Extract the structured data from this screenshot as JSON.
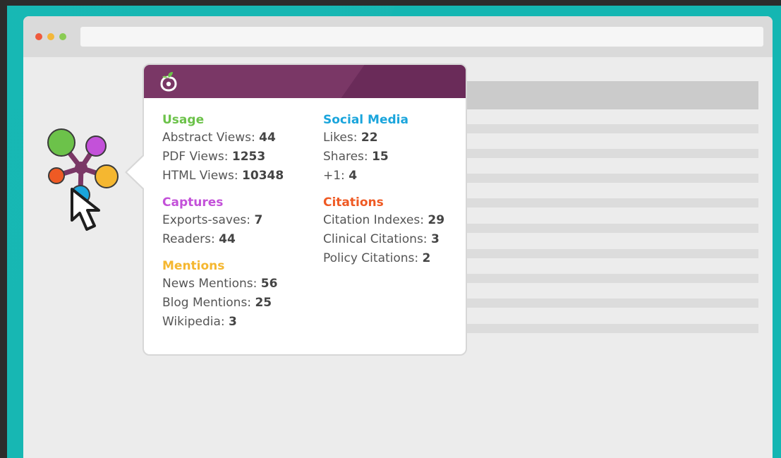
{
  "colors": {
    "teal": "#14b6b2",
    "header_purple": "#7a3766",
    "usage_green": "#6cc24a",
    "social_blue": "#1aa5dc",
    "captures_purple": "#c351d9",
    "citations_orange": "#ef5a24",
    "mentions_yellow": "#f5b730"
  },
  "browser": {
    "window_dots": [
      "close-dot",
      "minimize-dot",
      "maximize-dot"
    ]
  },
  "badge": {
    "icon": "plumx-flower-icon"
  },
  "popup": {
    "logo_icon": "plumx-logo-icon",
    "usage": {
      "title": "Usage",
      "rows": [
        {
          "label": "Abstract Views:",
          "value": "44"
        },
        {
          "label": "PDF Views:",
          "value": "1253"
        },
        {
          "label": "HTML Views:",
          "value": "10348"
        }
      ]
    },
    "captures": {
      "title": "Captures",
      "rows": [
        {
          "label": "Exports-saves:",
          "value": "7"
        },
        {
          "label": "Readers:",
          "value": "44"
        }
      ]
    },
    "mentions": {
      "title": "Mentions",
      "rows": [
        {
          "label": "News Mentions:",
          "value": "56"
        },
        {
          "label": "Blog Mentions:",
          "value": "25"
        },
        {
          "label": "Wikipedia:",
          "value": "3"
        }
      ]
    },
    "social_media": {
      "title": "Social Media",
      "rows": [
        {
          "label": "Likes:",
          "value": "22"
        },
        {
          "label": "Shares:",
          "value": "15"
        },
        {
          "label": "+1:",
          "value": "4"
        }
      ]
    },
    "citations": {
      "title": "Citations",
      "rows": [
        {
          "label": "Citation Indexes:",
          "value": "29"
        },
        {
          "label": "Clinical Citations:",
          "value": "3"
        },
        {
          "label": "Policy Citations:",
          "value": "2"
        }
      ]
    }
  }
}
